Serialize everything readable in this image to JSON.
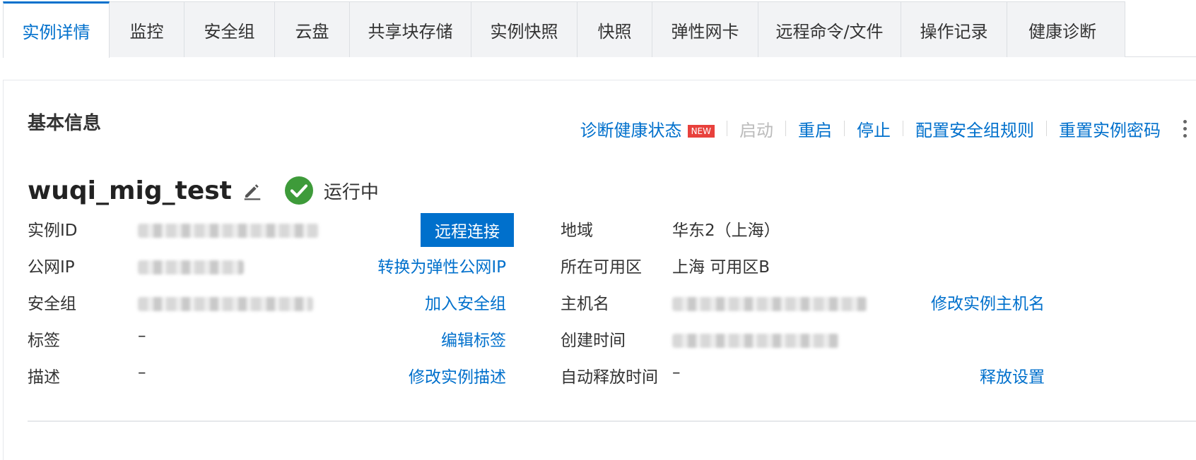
{
  "tabs": [
    "实例详情",
    "监控",
    "安全组",
    "云盘",
    "共享块存储",
    "实例快照",
    "快照",
    "弹性网卡",
    "远程命令/文件",
    "操作记录",
    "健康诊断"
  ],
  "panel": {
    "title": "基本信息",
    "actions": {
      "diagnose": "诊断健康状态",
      "new_badge": "NEW",
      "start": "启动",
      "restart": "重启",
      "stop": "停止",
      "config_sg": "配置安全组规则",
      "reset_pwd": "重置实例密码"
    },
    "instance": {
      "name": "wuqi_mig_test",
      "status": "运行中",
      "status_color": "#3e9b3a"
    },
    "left": {
      "id_label": "实例ID",
      "ip_label": "公网IP",
      "sg_label": "安全组",
      "tag_label": "标签",
      "tag_value": "–",
      "desc_label": "描述",
      "desc_value": "–",
      "remote_btn": "远程连接",
      "convert_eip": "转换为弹性公网IP",
      "join_sg": "加入安全组",
      "edit_tags": "编辑标签",
      "edit_desc": "修改实例描述"
    },
    "right": {
      "region_label": "地域",
      "region_value": "华东2（上海）",
      "zone_label": "所在可用区",
      "zone_value": "上海 可用区B",
      "host_label": "主机名",
      "edit_host": "修改实例主机名",
      "created_label": "创建时间",
      "release_label": "自动释放时间",
      "release_value": "–",
      "release_settings": "释放设置"
    }
  },
  "colors": {
    "accent": "#0070cc",
    "badge": "#e8413c"
  }
}
